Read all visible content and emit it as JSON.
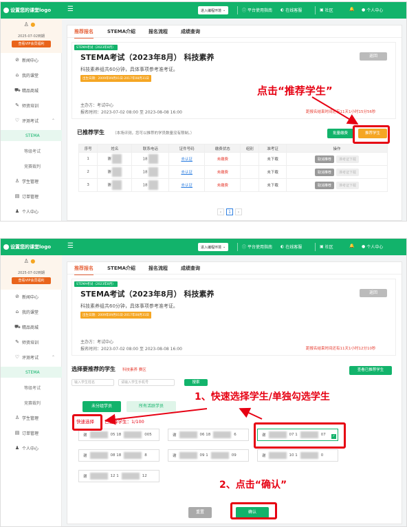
{
  "brand": {
    "logo_text": "设置您的课堂logo",
    "accent": "#12b36b",
    "alert": "#e60012",
    "warning": "#f5a623"
  },
  "topbar": {
    "env_select": "进入编程环境",
    "guide": "平台使用指南",
    "service": "在线客服",
    "community": "社区",
    "user": "个人中心"
  },
  "user": {
    "expire": "2025-07-02到期",
    "vip_button": "查看VIP会员福利"
  },
  "menu": [
    {
      "label": "新闻中心",
      "icon": "news-icon"
    },
    {
      "label": "我的课堂",
      "icon": "classroom-icon"
    },
    {
      "label": "精品商城",
      "icon": "cart-icon"
    },
    {
      "label": "师资培训",
      "icon": "training-icon"
    },
    {
      "label": "评测考试",
      "icon": "exam-icon"
    },
    {
      "label": "STEMA",
      "sub": true,
      "active": true
    },
    {
      "label": "等级考试",
      "sub": true
    },
    {
      "label": "竞赛裁判",
      "sub": true
    },
    {
      "label": "学生管理",
      "icon": "students-icon"
    },
    {
      "label": "订单管理",
      "icon": "orders-icon"
    },
    {
      "label": "个人中心",
      "icon": "person-icon"
    }
  ],
  "tabs": [
    "推荐报名",
    "STEMA介绍",
    "报名流程",
    "成绩查询"
  ],
  "exam": {
    "tag": "STEMA考试（2023年8月）",
    "title": "STEMA考试（2023年8月） 科技素养",
    "desc": "科技素养组共60分钟，具体事项参考准考证。",
    "date_badge": "出生日期：2009年09月01日-2017年08月31日",
    "back": "返回",
    "organizer": "主办方：考试中心",
    "reg_time": "报名时间：2023-07-02 08:00 至 2023-08-08 16:00"
  },
  "panel1": {
    "countdown": "距报名结束时间还有11天1小时15分56秒",
    "section_title": "已推荐学生",
    "section_note": "（本场评测，您可以推荐的学员数量没有限制。）",
    "batch_pay": "批量缴费",
    "recommend": "推荐学生",
    "annotation": "点击“推荐学生”",
    "columns": [
      "序号",
      "姓名",
      "联系电话",
      "证件号码",
      "缴费状态",
      "组别",
      "准考证",
      "操作"
    ],
    "rows": [
      {
        "no": "1",
        "name": "谢",
        "phone": "18",
        "id": "去认证",
        "pay": "未缴费",
        "group": "",
        "ticket": "未下载",
        "cancel": "取消推荐",
        "download": "准考证下载"
      },
      {
        "no": "2",
        "name": "谢",
        "phone": "18",
        "id": "去认证",
        "pay": "未缴费",
        "group": "",
        "ticket": "未下载",
        "cancel": "取消推荐",
        "download": "准考证下载"
      },
      {
        "no": "3",
        "name": "谢",
        "phone": "18",
        "id": "去认证",
        "pay": "未缴费",
        "group": "",
        "ticket": "未下载",
        "cancel": "取消推荐",
        "download": "准考证下载"
      }
    ],
    "page": "1"
  },
  "panel2": {
    "countdown": "距报名结束时间还有11天1小时12分10秒",
    "section_title": "选择要推荐的学生",
    "section_sub": "科技素养 赛区",
    "view_recommended": "查看已推荐学生",
    "name_placeholder": "输入学生姓名",
    "phone_placeholder": "请输入学生手机号",
    "search": "搜索",
    "group_tab1": "未分组学员",
    "group_tab2": "所有活跃学员",
    "quick_select": "快速选择",
    "selected_count": "已选择学生：1/100",
    "annotation1": "1、快速选择学生/单独勾选学生",
    "annotation2": "2、点击“确认”",
    "students": [
      {
        "name": "谢",
        "phone": "05 18",
        "tail": "005"
      },
      {
        "name": "谢",
        "phone": "06 18",
        "tail": "6"
      },
      {
        "name": "谢",
        "phone": "07 1",
        "tail": "07",
        "selected": true
      },
      {
        "name": "谢",
        "phone": "08 18",
        "tail": "8"
      },
      {
        "name": "谢",
        "phone": "09 1",
        "tail": "09"
      },
      {
        "name": "谢",
        "phone": "10 1",
        "tail": "0"
      },
      {
        "name": "谢",
        "phone": "12 1",
        "tail": "12"
      }
    ],
    "reset": "重置",
    "confirm": "确认"
  }
}
